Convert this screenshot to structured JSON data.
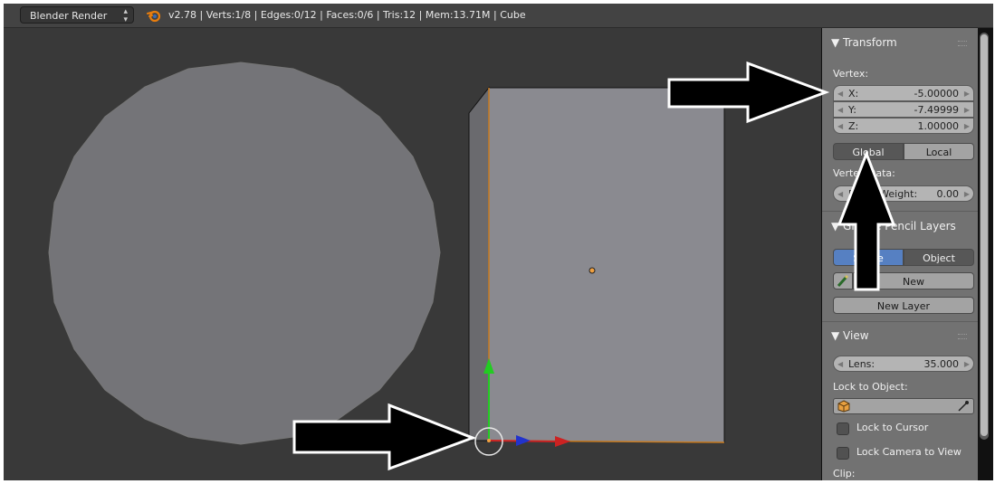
{
  "header": {
    "render_engine": "Blender Render",
    "render_engine_arrows": "▴▾",
    "stats": "v2.78 | Verts:1/8 | Edges:0/12 | Faces:0/6 | Tris:12 | Mem:13.71M | Cube"
  },
  "colors": {
    "viewport_bg": "#393939",
    "cube_face": "#8a8a90",
    "cylinder_face": "#747478",
    "panel_bg": "#727272",
    "selection_accent": "#5680c2",
    "x_axis": "#cc2222",
    "y_axis": "#22cc22",
    "z_axis": "#2233cc"
  },
  "panel": {
    "transform": {
      "title": "Transform",
      "vertex_label": "Vertex:",
      "x_label": "X:",
      "x_value": "-5.00000",
      "y_label": "Y:",
      "y_value": "-7.49999",
      "z_label": "Z:",
      "z_value": "1.00000",
      "global_label": "Global",
      "local_label": "Local",
      "vertex_data_label": "Vertex Data:",
      "bevel_weight_label": "Bevel Weight:",
      "bevel_weight_value": "0.00"
    },
    "grease_pencil": {
      "title": "Grease Pencil Layers",
      "scene_label": "Scene",
      "object_label": "Object",
      "new_label": "New",
      "new_layer_label": "New Layer"
    },
    "view": {
      "title": "View",
      "lens_label": "Lens:",
      "lens_value": "35.000",
      "lock_to_object_label": "Lock to Object:",
      "lock_to_cursor_label": "Lock to Cursor",
      "lock_camera_label": "Lock Camera to View",
      "clip_label": "Clip:"
    }
  },
  "icons": {
    "blender": "blender-logo-icon",
    "pencil": "pencil-icon",
    "cube": "cube-icon",
    "eyedropper": "eyedropper-icon",
    "arrow": "pointer-arrow"
  }
}
